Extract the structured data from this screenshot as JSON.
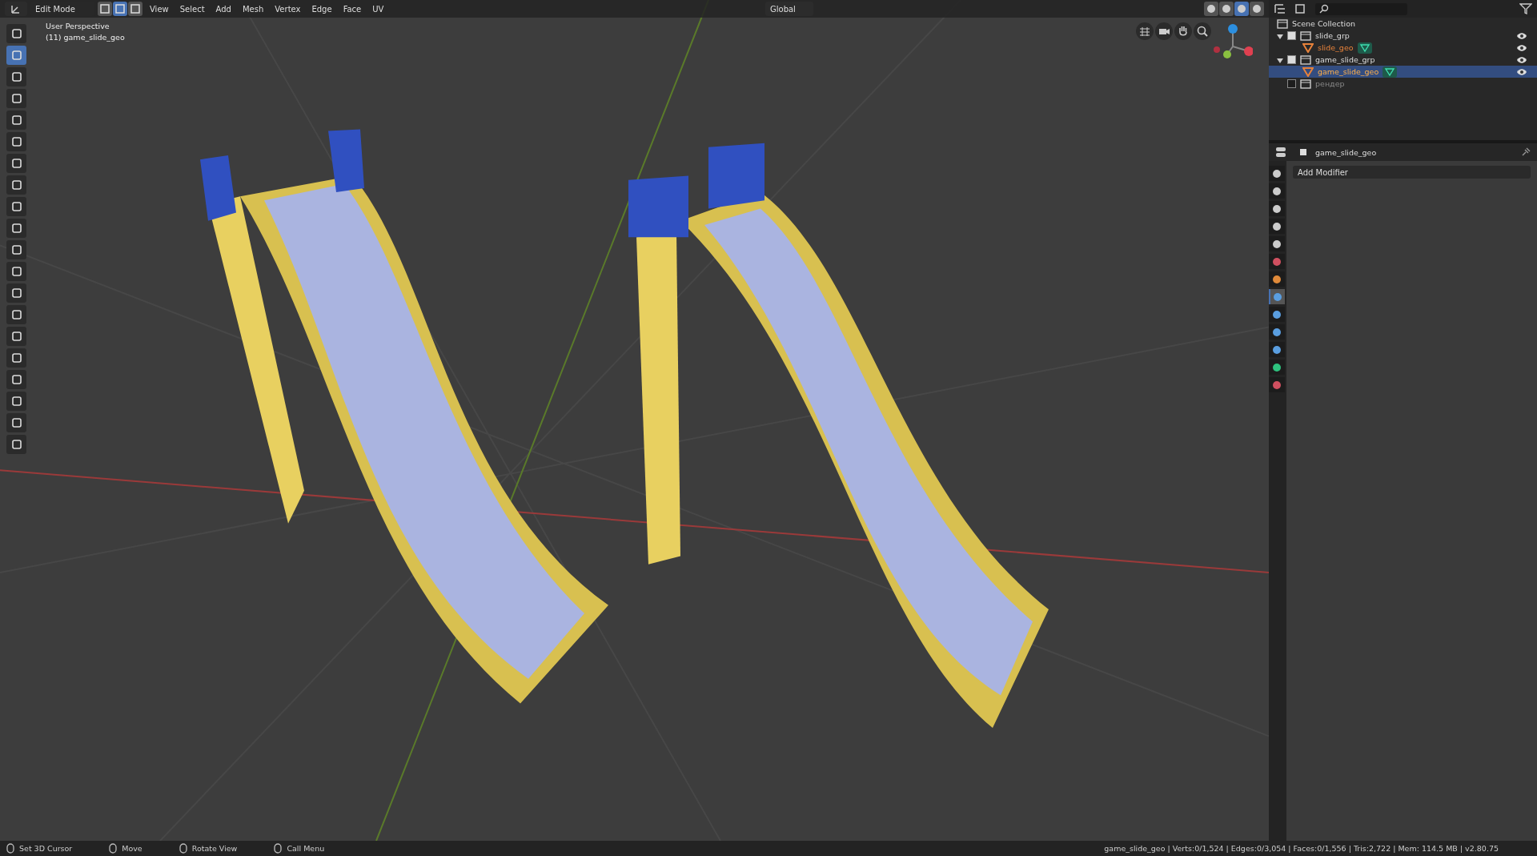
{
  "header": {
    "mode": "Edit Mode",
    "select_modes": [
      {
        "selected": false
      },
      {
        "selected": true
      },
      {
        "selected": false
      }
    ],
    "menus": [
      "View",
      "Select",
      "Add",
      "Mesh",
      "Vertex",
      "Edge",
      "Face",
      "UV"
    ],
    "orientation": "Global",
    "shading": [
      {
        "selected": false
      },
      {
        "selected": false
      },
      {
        "selected": true
      },
      {
        "selected": false
      }
    ]
  },
  "viewport": {
    "view_name": "User Perspective",
    "object_label": "(11) game_slide_geo",
    "tools": [
      {
        "selected": false
      },
      {
        "selected": true
      },
      {
        "selected": false
      },
      {
        "selected": false
      },
      {
        "selected": false
      },
      {
        "selected": false
      },
      {
        "selected": false
      },
      {
        "selected": false
      },
      {
        "selected": false
      },
      {
        "selected": false
      },
      {
        "selected": false
      },
      {
        "selected": false
      },
      {
        "selected": false
      },
      {
        "selected": false
      },
      {
        "selected": false
      },
      {
        "selected": false
      },
      {
        "selected": false
      },
      {
        "selected": false
      },
      {
        "selected": false
      },
      {
        "selected": false
      }
    ]
  },
  "outliner": {
    "root": "Scene Collection",
    "items": [
      {
        "label": "slide_grp",
        "checked": true,
        "children": [
          {
            "label": "slide_geo",
            "selected": false
          }
        ]
      },
      {
        "label": "game_slide_grp",
        "checked": true,
        "children": [
          {
            "label": "game_slide_geo",
            "selected": true
          }
        ]
      },
      {
        "label": "рендер",
        "checked": false
      }
    ]
  },
  "properties": {
    "object_name": "game_slide_geo",
    "add_modifier": "Add Modifier",
    "tabs": [
      {
        "selected": false,
        "color": "#cccccc"
      },
      {
        "selected": false,
        "color": "#cccccc"
      },
      {
        "selected": false,
        "color": "#cccccc"
      },
      {
        "selected": false,
        "color": "#cccccc"
      },
      {
        "selected": false,
        "color": "#cccccc"
      },
      {
        "selected": false,
        "color": "#d05060"
      },
      {
        "selected": false,
        "color": "#e08a3a"
      },
      {
        "selected": true,
        "color": "#5a9ee0"
      },
      {
        "selected": false,
        "color": "#5a9ee0"
      },
      {
        "selected": false,
        "color": "#5a9ee0"
      },
      {
        "selected": false,
        "color": "#5a9ee0"
      },
      {
        "selected": false,
        "color": "#2ec27e"
      },
      {
        "selected": false,
        "color": "#d05060"
      }
    ]
  },
  "status_bar": {
    "hints": [
      "Set 3D Cursor",
      "Move",
      "Rotate View",
      "Call Menu"
    ],
    "stats": "game_slide_geo | Verts:0/1,524 | Edges:0/3,054 | Faces:0/1,556 | Tris:2,722 | Mem: 114.5 MB | v2.80.75"
  }
}
